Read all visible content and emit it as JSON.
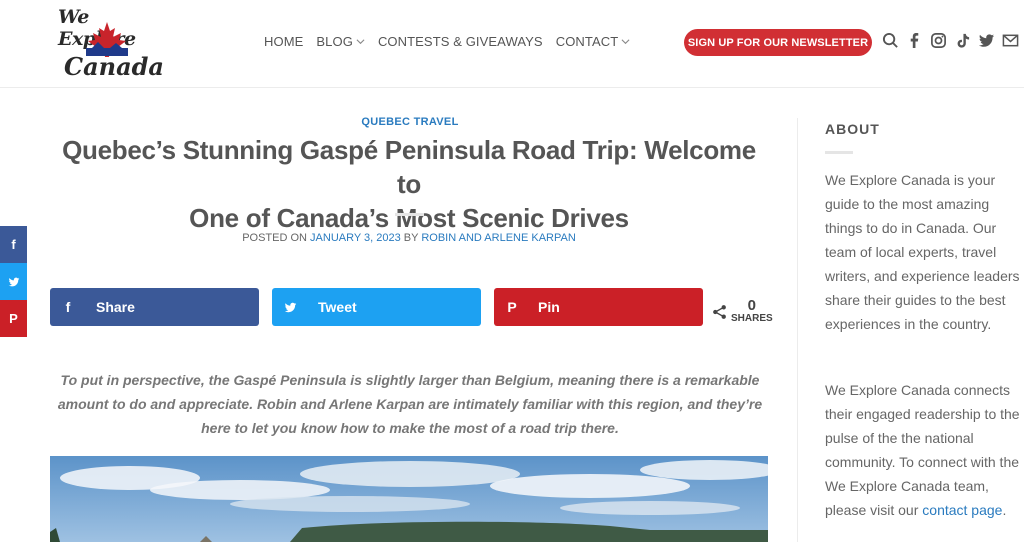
{
  "logo": {
    "top_text": "We Explore",
    "bottom_text": "Canada"
  },
  "nav": {
    "items": [
      {
        "label": "HOME",
        "has_dropdown": false
      },
      {
        "label": "BLOG",
        "has_dropdown": true
      },
      {
        "label": "CONTESTS & GIVEAWAYS",
        "has_dropdown": false
      },
      {
        "label": "CONTACT",
        "has_dropdown": true
      }
    ],
    "newsletter_label": "SIGN UP FOR OUR NEWSLETTER"
  },
  "header_icons": [
    "search-icon",
    "facebook-icon",
    "instagram-icon",
    "tiktok-icon",
    "twitter-icon",
    "email-icon"
  ],
  "float_share": [
    {
      "name": "facebook",
      "glyph": "f",
      "color": "#3b5998"
    },
    {
      "name": "twitter",
      "glyph": "🐦",
      "color": "#1da1f2"
    },
    {
      "name": "pinterest",
      "glyph": "P",
      "color": "#cb2027"
    }
  ],
  "article": {
    "category": "QUEBEC TRAVEL",
    "title_line1": "Quebec’s Stunning Gaspé Peninsula Road Trip: Welcome to",
    "title_line2": "One of Canada’s Most Scenic Drives",
    "posted_prefix": "POSTED ON ",
    "posted_date": "JANUARY 3, 2023",
    "posted_by": " BY ",
    "author": "ROBIN AND ARLENE KARPAN",
    "share_buttons": [
      {
        "label": "Share",
        "glyph": "f",
        "color": "#3b5998"
      },
      {
        "label": "Tweet",
        "glyph": "t",
        "color": "#1da1f2"
      },
      {
        "label": "Pin",
        "glyph": "P",
        "color": "#cb2027"
      }
    ],
    "share_count": "0",
    "share_count_label": "SHARES",
    "intro": "To put in perspective, the Gaspé Peninsula is slightly larger than Belgium, meaning there is a remarkable amount to do and appreciate. Robin and Arlene Karpan are intimately familiar with this region, and they’re here to let you know how to make the most of a road trip there."
  },
  "sidebar": {
    "about_title": "ABOUT",
    "p1": "We Explore Canada is your guide to the most amazing things to do in Canada. Our team of local experts, travel writers, and experience leaders share their guides to the best experiences in the country.",
    "p2_text": "We Explore Canada connects their engaged readership to the pulse of the the national community. To connect with the We Explore Canada team, please visit our ",
    "p2_link": "contact page",
    "p2_end": "."
  },
  "colors": {
    "accent_red": "#d12f34",
    "link_blue": "#2a7bbf",
    "facebook": "#3b5998",
    "twitter": "#1da1f2",
    "pinterest": "#cb2027"
  }
}
